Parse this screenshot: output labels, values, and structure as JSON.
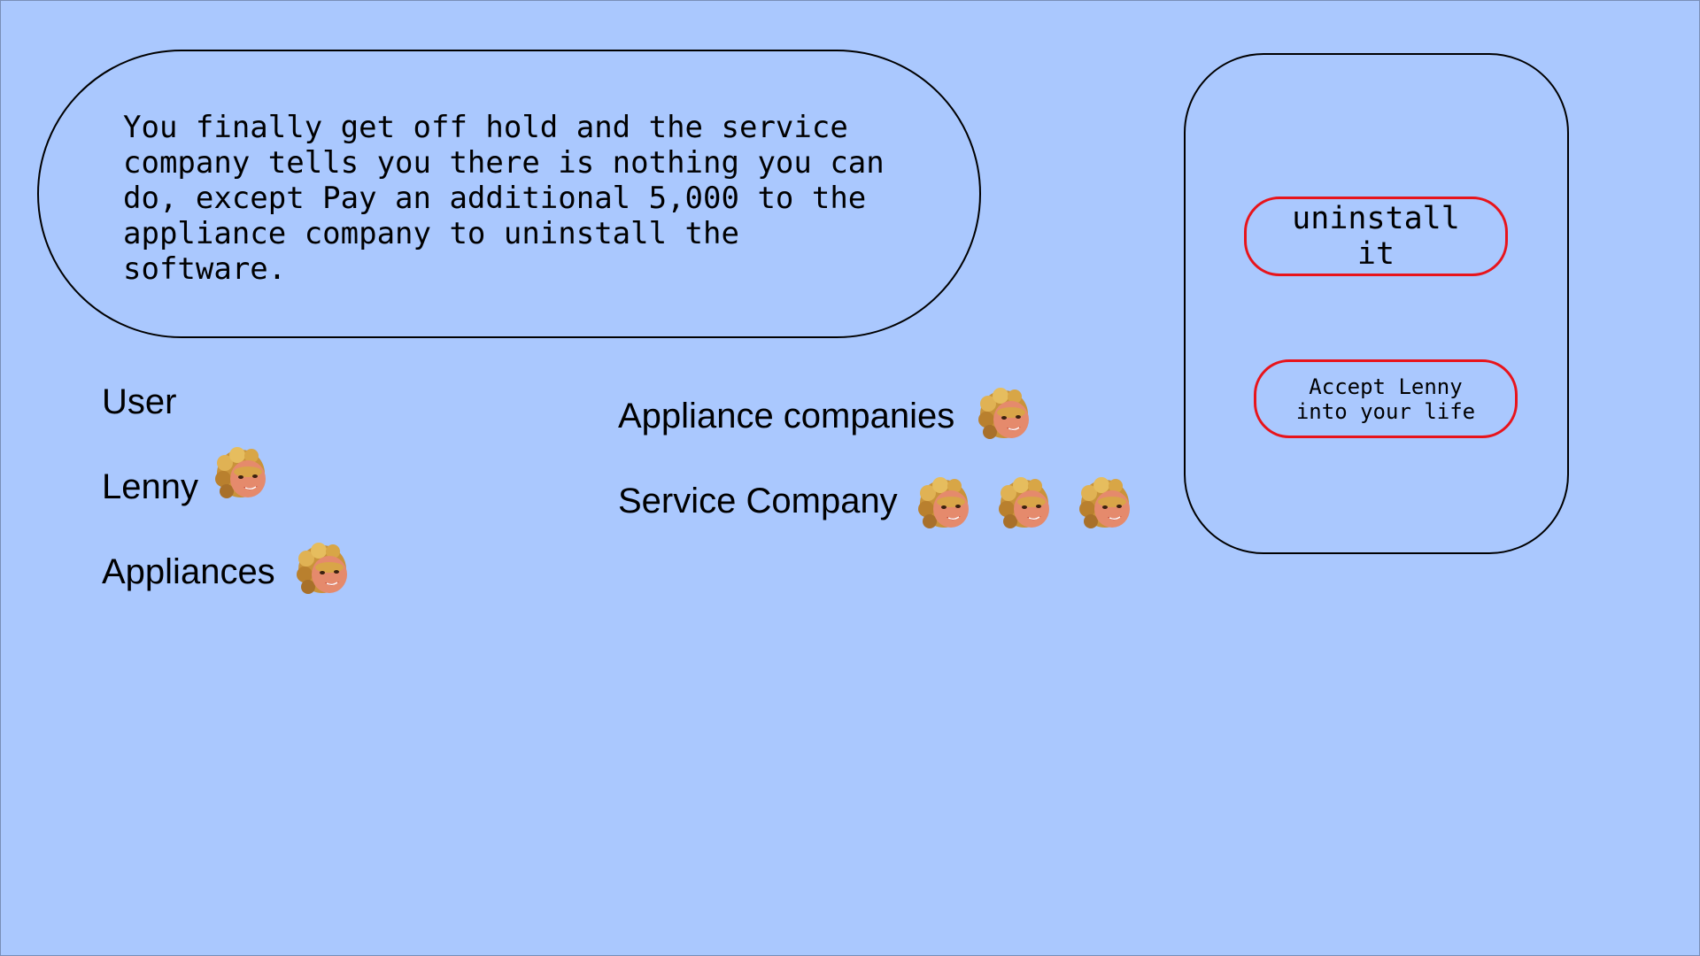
{
  "story": {
    "text": "You finally get off hold and the service\ncompany tells you there is nothing you can\ndo, except Pay an additional 5,000 to the\nappliance company to uninstall the\nsoftware."
  },
  "choices": {
    "uninstall_label": "uninstall\nit",
    "accept_label": "Accept Lenny\ninto your life"
  },
  "stats": {
    "user": {
      "label": "User",
      "tokens": 0
    },
    "lenny": {
      "label": "Lenny",
      "tokens": 1
    },
    "appliances": {
      "label": "Appliances",
      "tokens": 1
    },
    "appliance_companies": {
      "label": "Appliance companies",
      "tokens": 1
    },
    "service_company": {
      "label": "Service Company",
      "tokens": 3
    }
  },
  "icons": {
    "token": "lenny-face-icon"
  },
  "colors": {
    "background": "#aac8fe",
    "button_border": "#e8141b"
  }
}
